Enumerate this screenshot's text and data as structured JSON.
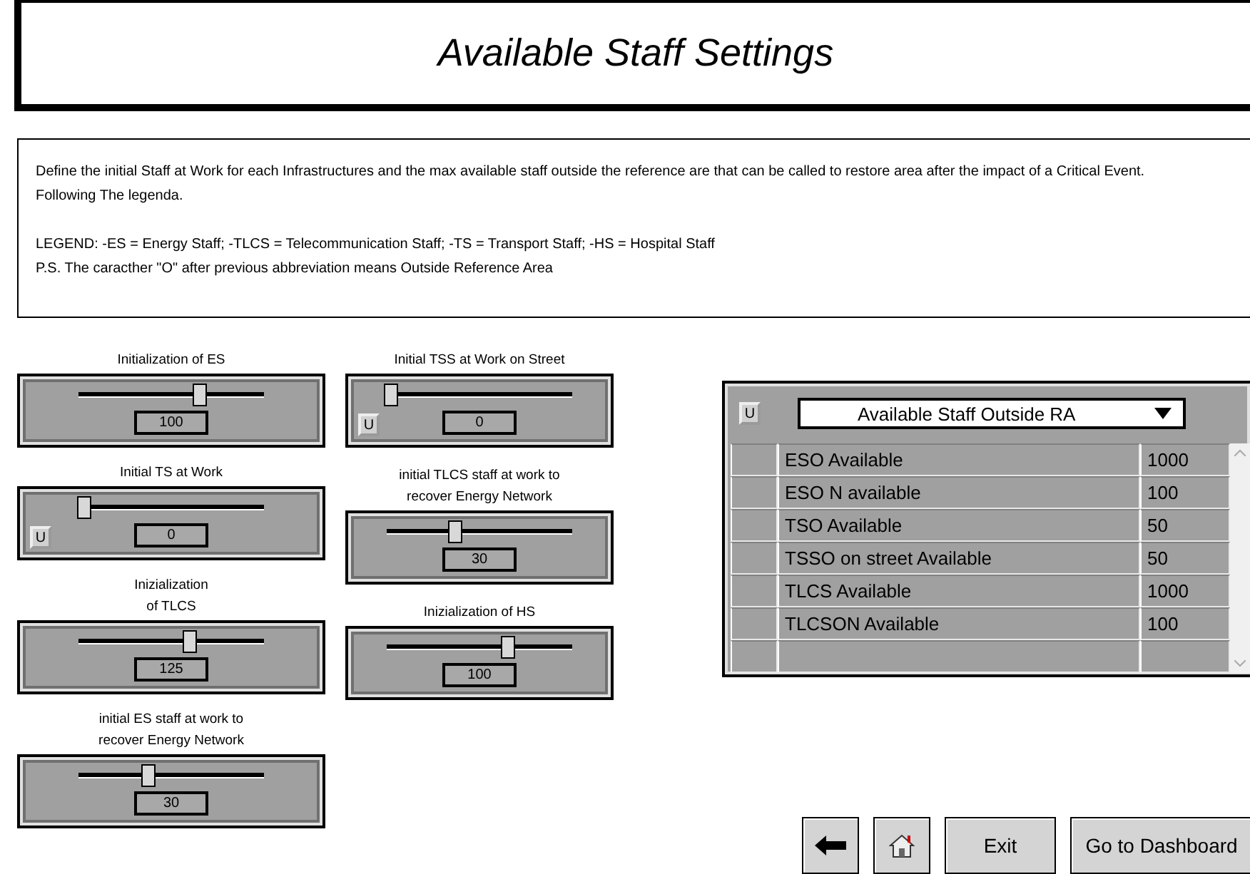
{
  "title": "Available Staff Settings",
  "description": {
    "paragraph": "Define the initial Staff at Work for each Infrastructures and the max available staff outside the reference are that can be called to restore area after the impact of a Critical Event. Following The legenda.",
    "legend": "LEGEND: -ES = Energy Staff; -TLCS = Telecommunication Staff;  -TS = Transport Staff; -HS = Hospital Staff",
    "note": "P.S. The caracther \"O\" after previous abbreviation means Outside Reference Area"
  },
  "slider_columns": [
    [
      {
        "label": "Initialization of ES",
        "value": "100",
        "level": 0.65
      },
      {
        "label": "Initial TS at Work",
        "value": "0",
        "level": 0.03,
        "u_button": "U"
      },
      {
        "label": "Inizialization\nof TLCS",
        "value": "125",
        "level": 0.6
      },
      {
        "label": "initial ES staff at work to\nrecover Energy Network",
        "value": "30",
        "level": 0.38
      }
    ],
    [
      {
        "label": "Initial TSS at Work on Street",
        "value": "0",
        "level": 0.02,
        "u_button": "U"
      },
      {
        "label": "initial TLCS staff at work to\nrecover Energy Network",
        "value": "30",
        "level": 0.37
      },
      {
        "label": "Inizialization of HS",
        "value": "100",
        "level": 0.65
      }
    ]
  ],
  "table": {
    "u_button": "U",
    "dropdown": "Available Staff Outside RA",
    "rows": [
      {
        "name": "ESO Available",
        "value": "1000"
      },
      {
        "name": "ESO N available",
        "value": "100"
      },
      {
        "name": "TSO Available",
        "value": "50"
      },
      {
        "name": "TSSO  on street  Available",
        "value": "50"
      },
      {
        "name": "TLCS Available",
        "value": "1000"
      },
      {
        "name": "TLCSON Available",
        "value": "100"
      }
    ]
  },
  "buttons": [
    {
      "kind": "back"
    },
    {
      "kind": "home"
    },
    {
      "kind": "text",
      "label": "Exit"
    },
    {
      "kind": "text",
      "label": "Go to Dashboard"
    }
  ]
}
